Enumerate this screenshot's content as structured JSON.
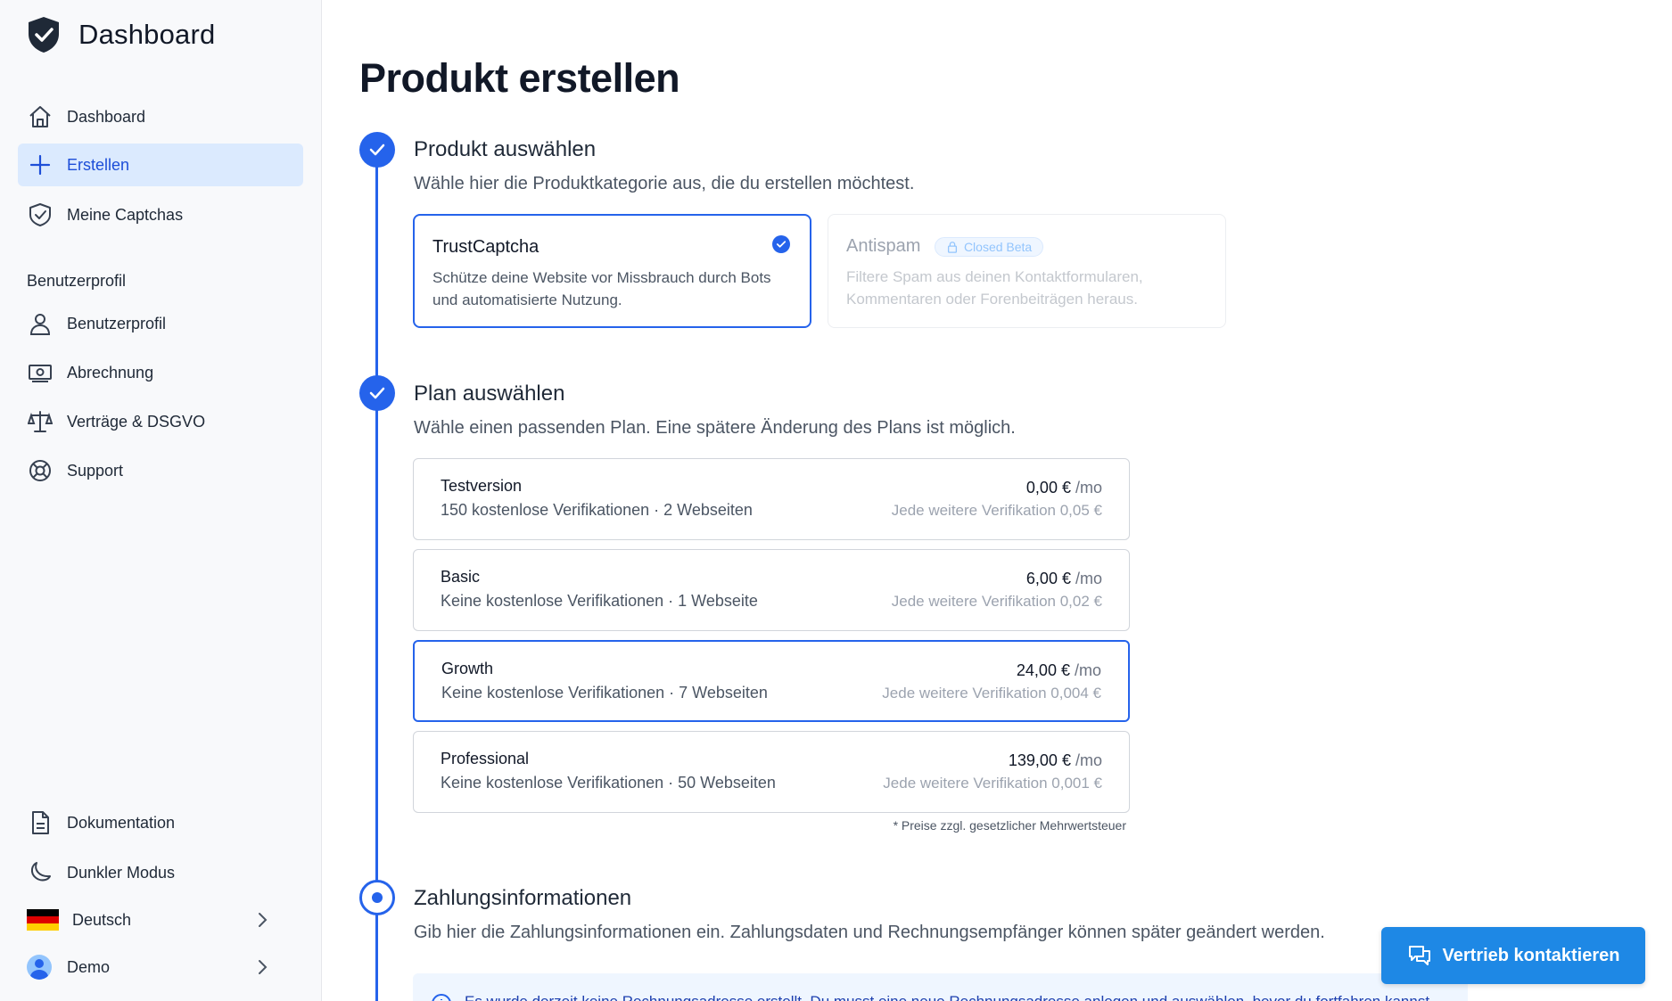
{
  "brand": {
    "title": "Dashboard",
    "icon": "shield-check-icon"
  },
  "sidebar": {
    "nav": [
      {
        "label": "Dashboard",
        "icon": "home-icon"
      },
      {
        "label": "Erstellen",
        "icon": "plus-icon",
        "active": true
      },
      {
        "label": "Meine Captchas",
        "icon": "shield-check-outline-icon"
      }
    ],
    "section_label": "Benutzerprofil",
    "profile_nav": [
      {
        "label": "Benutzerprofil",
        "icon": "user-icon"
      },
      {
        "label": "Abrechnung",
        "icon": "banknote-icon"
      },
      {
        "label": "Verträge & DSGVO",
        "icon": "scale-icon"
      },
      {
        "label": "Support",
        "icon": "lifebuoy-icon"
      }
    ],
    "bottom": {
      "docs": "Dokumentation",
      "dark_mode": "Dunkler Modus",
      "language": "Deutsch",
      "user": "Demo"
    }
  },
  "main": {
    "title": "Produkt erstellen",
    "steps": [
      {
        "title": "Produkt auswählen",
        "description": "Wähle hier die Produktkategorie aus, die du erstellen möchtest.",
        "status": "done"
      },
      {
        "title": "Plan auswählen",
        "description": "Wähle einen passenden Plan. Eine spätere Änderung des Plans ist möglich.",
        "status": "done"
      },
      {
        "title": "Zahlungsinformationen",
        "description": "Gib hier die Zahlungsinformationen ein. Zahlungsdaten und Rechnungsempfänger können später geändert werden.",
        "status": "current"
      }
    ],
    "products": [
      {
        "title": "TrustCaptcha",
        "description": "Schütze deine Website vor Missbrauch durch Bots und automatisierte Nutzung.",
        "selected": true
      },
      {
        "title": "Antispam",
        "badge": "Closed Beta",
        "description": "Filtere Spam aus deinen Kontaktformularen, Kommentaren oder Forenbeiträgen heraus.",
        "disabled": true
      }
    ],
    "plans": [
      {
        "name": "Testversion",
        "details": "150 kostenlose Verifikationen · 2 Webseiten",
        "price": "0,00 €",
        "per": "/mo",
        "extra": "Jede weitere Verifikation 0,05 €"
      },
      {
        "name": "Basic",
        "details": "Keine kostenlose Verifikationen · 1 Webseite",
        "price": "6,00 €",
        "per": "/mo",
        "extra": "Jede weitere Verifikation 0,02 €"
      },
      {
        "name": "Growth",
        "details": "Keine kostenlose Verifikationen · 7 Webseiten",
        "price": "24,00 €",
        "per": "/mo",
        "extra": "Jede weitere Verifikation 0,004 €",
        "selected": true
      },
      {
        "name": "Professional",
        "details": "Keine kostenlose Verifikationen · 50 Webseiten",
        "price": "139,00 €",
        "per": "/mo",
        "extra": "Jede weitere Verifikation 0,001 €"
      }
    ],
    "vat_note": "* Preise zzgl. gesetzlicher Mehrwertsteuer",
    "info_text": "Es wurde derzeit keine Rechnungsadresse erstellt. Du musst eine neue Rechnungsadresse anlegen und auswählen, bevor du fortfahren kannst."
  },
  "contact_button": {
    "label": "Vertrieb kontaktieren",
    "icon": "chat-bubbles-icon"
  },
  "colors": {
    "accent": "#2563eb",
    "active_bg": "#dbeafe",
    "contact_btn": "#1e88e5"
  }
}
